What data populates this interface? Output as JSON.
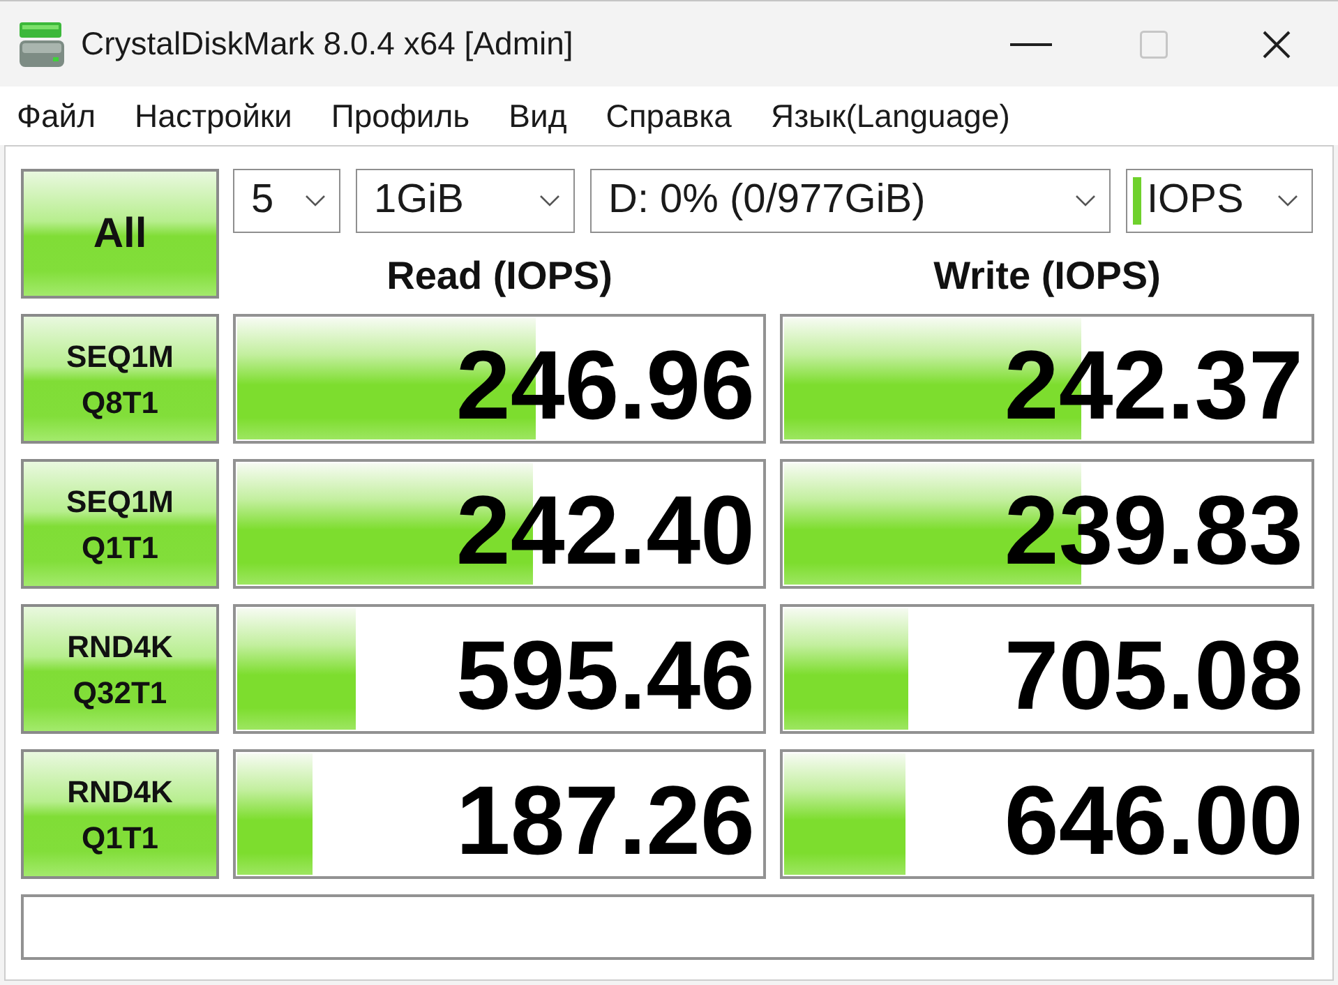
{
  "window": {
    "title": "CrystalDiskMark 8.0.4 x64 [Admin]",
    "controls": [
      {
        "kind": "minimize",
        "disabled": false
      },
      {
        "kind": "maximize",
        "disabled": true
      },
      {
        "kind": "close",
        "disabled": false
      }
    ]
  },
  "menu": [
    "Файл",
    "Настройки",
    "Профиль",
    "Вид",
    "Справка",
    "Язык(Language)"
  ],
  "all_button": "All",
  "dropdowns": [
    {
      "kind": "count",
      "value": "5"
    },
    {
      "kind": "size",
      "value": "1GiB"
    },
    {
      "kind": "drive",
      "value": "D: 0% (0/977GiB)"
    },
    {
      "kind": "unit",
      "value": "IOPS"
    }
  ],
  "columns": [
    "Read (IOPS)",
    "Write (IOPS)"
  ],
  "tests": [
    {
      "name": "SEQ1M",
      "params": "Q8T1",
      "read": {
        "reading": "246.96",
        "level": 0.567
      },
      "write": {
        "reading": "242.37",
        "level": 0.563
      }
    },
    {
      "name": "SEQ1M",
      "params": "Q1T1",
      "read": {
        "reading": "242.40",
        "level": 0.562
      },
      "write": {
        "reading": "239.83",
        "level": 0.563
      }
    },
    {
      "name": "RND4K",
      "params": "Q32T1",
      "read": {
        "reading": "595.46",
        "level": 0.226
      },
      "write": {
        "reading": "705.08",
        "level": 0.236
      }
    },
    {
      "name": "RND4K",
      "params": "Q1T1",
      "read": {
        "reading": "187.26",
        "level": 0.142
      },
      "write": {
        "reading": "646.00",
        "level": 0.23
      }
    }
  ]
}
